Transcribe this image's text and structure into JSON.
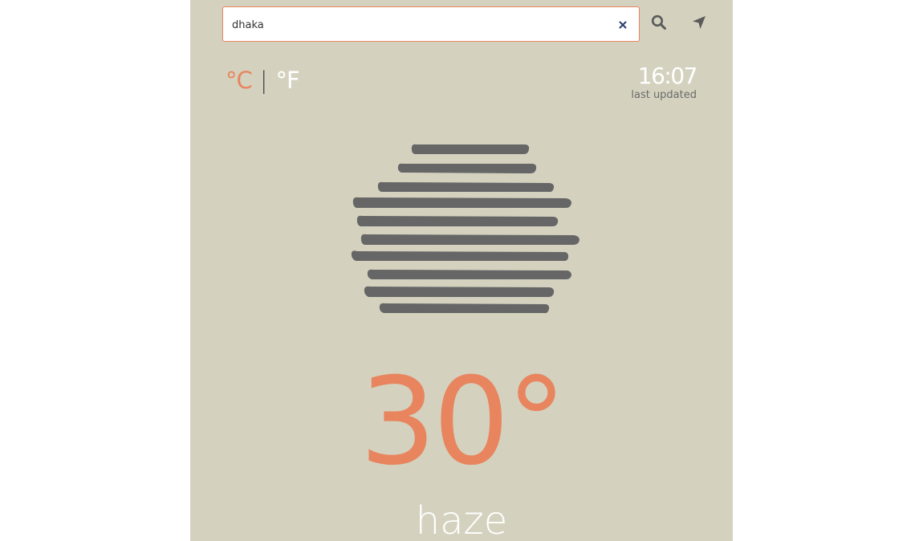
{
  "search": {
    "value": "dhaka",
    "placeholder": ""
  },
  "units": {
    "celsius": "°C",
    "separator": "|",
    "fahrenheit": "°F",
    "active": "celsius"
  },
  "updated": {
    "time": "16:07",
    "label": "last updated"
  },
  "weather": {
    "temperature": "30°",
    "condition": "haze",
    "icon": "haze-icon"
  },
  "colors": {
    "accent": "#e8855f",
    "background": "#d4d2bf",
    "icon": "#666666"
  }
}
